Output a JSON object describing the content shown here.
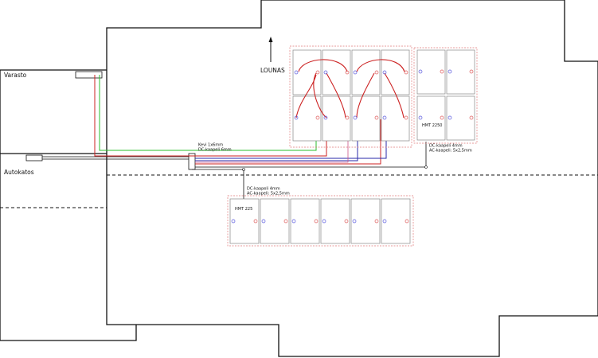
{
  "rooms": {
    "storage": "Varasto",
    "carport": "Autokatos"
  },
  "compass": {
    "label": "LOUNAS"
  },
  "cables": {
    "main_line1": "Kevi 1x6mm",
    "main_line2": "DC-kaapeli 6mm",
    "east_line1": "DC-kaapeli 4mm",
    "east_line2": "AC-kaapeli: 5x2,5mm",
    "south_line1": "DC-kaapeli 4mm",
    "south_line2": "AC-kaapeli: 5x2,5mm"
  },
  "inverters": {
    "east": "HMT 2250",
    "south": "HMT 225"
  },
  "colors": {
    "wall": "#111111",
    "array_outline": "#e07a7a",
    "string_red": "#cc2222",
    "string_blue": "#2a2aa8",
    "ground_green": "#2bbf2b",
    "dot_blue": "#5555dd",
    "dot_red": "#dd5555"
  }
}
